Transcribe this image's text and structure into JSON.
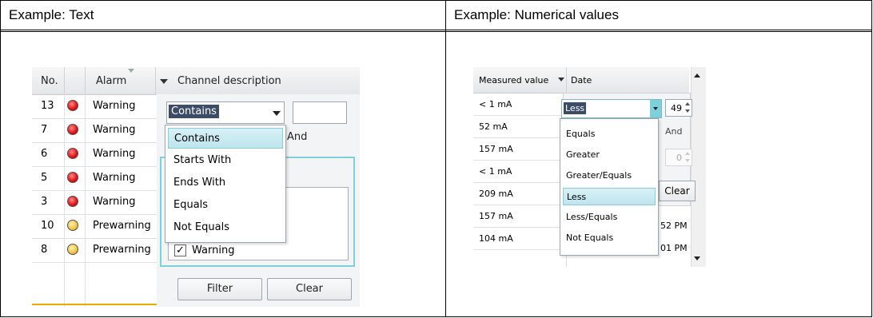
{
  "document": {
    "left_header": "Example: Text",
    "right_header": "Example: Numerical values"
  },
  "text_example": {
    "columns": {
      "no": "No.",
      "alarm": "Alarm",
      "channel": "Channel description"
    },
    "rows": [
      {
        "no": "13",
        "status": "red",
        "alarm": "Warning"
      },
      {
        "no": "7",
        "status": "red",
        "alarm": "Warning"
      },
      {
        "no": "6",
        "status": "red",
        "alarm": "Warning"
      },
      {
        "no": "5",
        "status": "red",
        "alarm": "Warning"
      },
      {
        "no": "3",
        "status": "red",
        "alarm": "Warning"
      },
      {
        "no": "10",
        "status": "yellow",
        "alarm": "Prewarning"
      },
      {
        "no": "8",
        "status": "yellow",
        "alarm": "Prewarning"
      }
    ],
    "filter_combo": {
      "value": "Contains"
    },
    "and_label": "And",
    "dropdown_options": [
      "Contains",
      "Starts With",
      "Ends With",
      "Equals",
      "Not Equals"
    ],
    "selected_option": "Contains",
    "checkbox": {
      "label": "Warning",
      "checked": true,
      "mark": "✓"
    },
    "buttons": {
      "filter": "Filter",
      "clear": "Clear"
    },
    "colors": {
      "accent": "#7fd0dd",
      "selection": "#bde5ee",
      "header_text_bg": "#3d4c66"
    }
  },
  "numeric_example": {
    "columns": {
      "measured": "Measured value",
      "date": "Date"
    },
    "rows": [
      "< 1 mA",
      "52 mA",
      "157 mA",
      "< 1 mA",
      "209 mA",
      "157 mA",
      "104 mA"
    ],
    "date_fragments": [
      "52 PM",
      "01 PM"
    ],
    "filter_combo": {
      "value": "Less"
    },
    "first_value": "49",
    "second_value": "0",
    "and_label": "And",
    "clear_label": "Clear",
    "dropdown_options": [
      "Equals",
      "Greater",
      "Greater/Equals",
      "Less",
      "Less/Equals",
      "Not Equals"
    ],
    "selected_option": "Less"
  }
}
